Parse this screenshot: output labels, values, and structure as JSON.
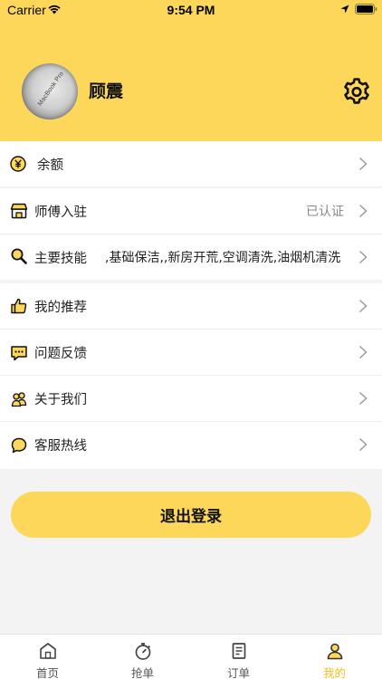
{
  "status_bar": {
    "carrier": "Carrier",
    "time": "9:54 PM"
  },
  "profile": {
    "name": "顾震",
    "avatar_text": "MacBook Pro"
  },
  "menu": {
    "balance": {
      "label": "余额",
      "icon": "yen-coin-icon"
    },
    "master_join": {
      "label": "师傅入驻",
      "value": "已认证",
      "icon": "storefront-icon"
    },
    "main_skills": {
      "label": "主要技能",
      "value": ",基础保洁,,新房开荒,空调清洗,油烟机清洗",
      "icon": "magnifier-icon"
    },
    "my_recommend": {
      "label": "我的推荐",
      "icon": "thumbs-up-icon"
    },
    "feedback": {
      "label": "问题反馈",
      "icon": "chat-bubble-icon"
    },
    "about_us": {
      "label": "关于我们",
      "icon": "people-icon"
    },
    "service_hotline": {
      "label": "客服热线",
      "icon": "chat-circle-icon"
    }
  },
  "logout_label": "退出登录",
  "tabs": [
    {
      "label": "首页",
      "icon": "home-icon"
    },
    {
      "label": "抢单",
      "icon": "stopwatch-icon"
    },
    {
      "label": "订单",
      "icon": "document-icon"
    },
    {
      "label": "我的",
      "icon": "user-icon",
      "active": true
    }
  ],
  "colors": {
    "accent": "#fcd75a",
    "active_tab": "#f5c01e",
    "background": "#f3f3f3"
  }
}
